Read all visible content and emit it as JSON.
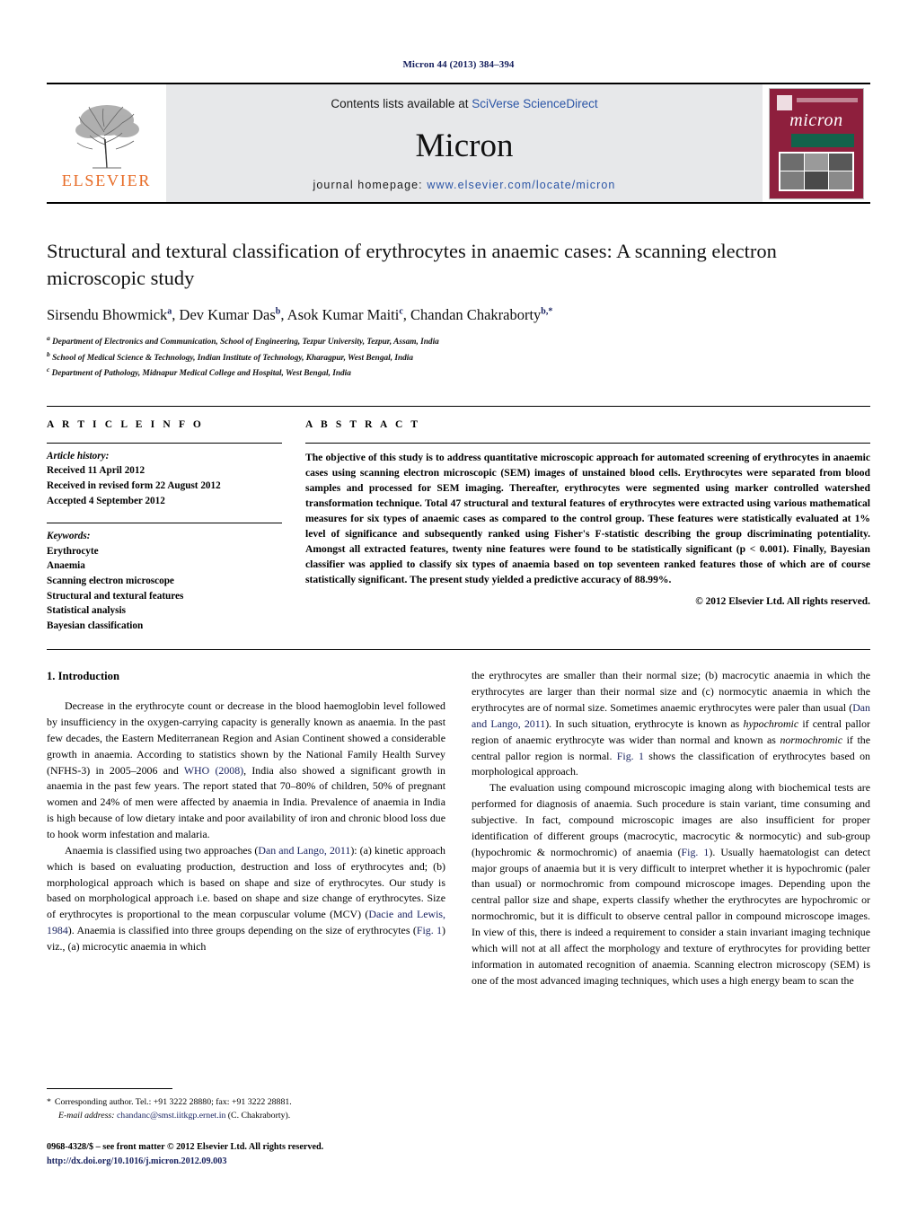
{
  "running_head": "Micron 44 (2013) 384–394",
  "masthead": {
    "publisher_name": "ELSEVIER",
    "contents_prefix": "Contents lists available at ",
    "contents_link": "SciVerse ScienceDirect",
    "journal_name": "Micron",
    "homepage_prefix": "journal homepage: ",
    "homepage_url": "www.elsevier.com/locate/micron",
    "cover_title": "micron",
    "cover_color": "#8e1f3d",
    "link_color": "#2b55a6"
  },
  "article": {
    "title": "Structural and textural classification of erythrocytes in anaemic cases: A scanning electron microscopic study",
    "authors_plain": "Sirsendu Bhowmick a, Dev Kumar Das b, Asok Kumar Maiti c, Chandan Chakraborty b,*",
    "affiliations": [
      {
        "marker": "a",
        "text": "Department of Electronics and Communication, School of Engineering, Tezpur University, Tezpur, Assam, India"
      },
      {
        "marker": "b",
        "text": "School of Medical Science & Technology, Indian Institute of Technology, Kharagpur, West Bengal, India"
      },
      {
        "marker": "c",
        "text": "Department of Pathology, Midnapur Medical College and Hospital, West Bengal, India"
      }
    ]
  },
  "article_info": {
    "heading": "A R T I C L E   I N F O",
    "history_label": "Article history:",
    "history": [
      "Received 11 April 2012",
      "Received in revised form 22 August 2012",
      "Accepted 4 September 2012"
    ],
    "keywords_label": "Keywords:",
    "keywords": [
      "Erythrocyte",
      "Anaemia",
      "Scanning electron microscope",
      "Structural and textural features",
      "Statistical analysis",
      "Bayesian classification"
    ]
  },
  "abstract": {
    "heading": "A B S T R A C T",
    "text": "The objective of this study is to address quantitative microscopic approach for automated screening of erythrocytes in anaemic cases using scanning electron microscopic (SEM) images of unstained blood cells. Erythrocytes were separated from blood samples and processed for SEM imaging. Thereafter, erythrocytes were segmented using marker controlled watershed transformation technique. Total 47 structural and textural features of erythrocytes were extracted using various mathematical measures for six types of anaemic cases as compared to the control group. These features were statistically evaluated at 1% level of significance and subsequently ranked using Fisher's F-statistic describing the group discriminating potentiality. Amongst all extracted features, twenty nine features were found to be statistically significant (p < 0.001). Finally, Bayesian classifier was applied to classify six types of anaemia based on top seventeen ranked features those of which are of course statistically significant. The present study yielded a predictive accuracy of 88.99%.",
    "copyright": "© 2012 Elsevier Ltd. All rights reserved."
  },
  "body": {
    "section_number_title": "1.  Introduction",
    "left_paragraphs": [
      "Decrease in the erythrocyte count or decrease in the blood haemoglobin level followed by insufficiency in the oxygen-carrying capacity is generally known as anaemia. In the past few decades, the Eastern Mediterranean Region and Asian Continent showed a considerable growth in anaemia. According to statistics shown by the National Family Health Survey (NFHS-3) in 2005–2006 and ",
      "WHO (2008)",
      ", India also showed a significant growth in anaemia in the past few years. The report stated that 70–80% of children, 50% of pregnant women and 24% of men were affected by anaemia in India. Prevalence of anaemia in India is high because of low dietary intake and poor availability of iron and chronic blood loss due to hook worm infestation and malaria.",
      "Anaemia is classified using two approaches (",
      "Dan and Lango, 2011",
      "): (a) kinetic approach which is based on evaluating production, destruction and loss of erythrocytes and; (b) morphological approach which is based on shape and size of erythrocytes. Our study is based on morphological approach i.e. based on shape and size change of erythrocytes. Size of erythrocytes is proportional to the mean corpuscular volume (MCV) (",
      "Dacie and Lewis, 1984",
      "). Anaemia is classified into three groups depending on the size of erythrocytes (",
      "Fig. 1",
      ") viz., (a) microcytic anaemia in which"
    ],
    "right_paragraphs": [
      "the erythrocytes are smaller than their normal size; (b) macrocytic anaemia in which the erythrocytes are larger than their normal size and (c) normocytic anaemia in which the erythrocytes are of normal size. Sometimes anaemic erythrocytes were paler than usual (",
      "Dan and Lango, 2011",
      "). In such situation, erythrocyte is known as ",
      "hypochromic",
      " if central pallor region of anaemic erythrocyte was wider than normal and known as ",
      "normochromic",
      " if the central pallor region is normal. ",
      "Fig. 1",
      " shows the classification of erythrocytes based on morphological approach.",
      "The evaluation using compound microscopic imaging along with biochemical tests are performed for diagnosis of anaemia. Such procedure is stain variant, time consuming and subjective. In fact, compound microscopic images are also insufficient for proper identification of different groups (macrocytic, macrocytic & normocytic) and sub-group (hypochromic & normochromic) of anaemia (",
      "Fig. 1",
      "). Usually haematologist can detect major groups of anaemia but it is very difficult to interpret whether it is hypochromic (paler than usual) or normochromic from compound microscope images. Depending upon the central pallor size and shape, experts classify whether the erythrocytes are hypochromic or normochromic, but it is difficult to observe central pallor in compound microscope images. In view of this, there is indeed a requirement to consider a stain invariant imaging technique which will not at all affect the morphology and texture of erythrocytes for providing better information in automated recognition of anaemia. Scanning electron microscopy (SEM) is one of the most advanced imaging techniques, which uses a high energy beam to scan the"
    ]
  },
  "footnote": {
    "star": "*",
    "corresponding": "Corresponding author. Tel.: +91 3222 28880; fax: +91 3222 28881.",
    "email_label": "E-mail address:",
    "email": "chandanc@smst.iitkgp.ernet.in",
    "email_owner": "(C. Chakraborty).",
    "frontmatter": "0968-4328/$ – see front matter © 2012 Elsevier Ltd. All rights reserved.",
    "doi": "http://dx.doi.org/10.1016/j.micron.2012.09.003"
  }
}
